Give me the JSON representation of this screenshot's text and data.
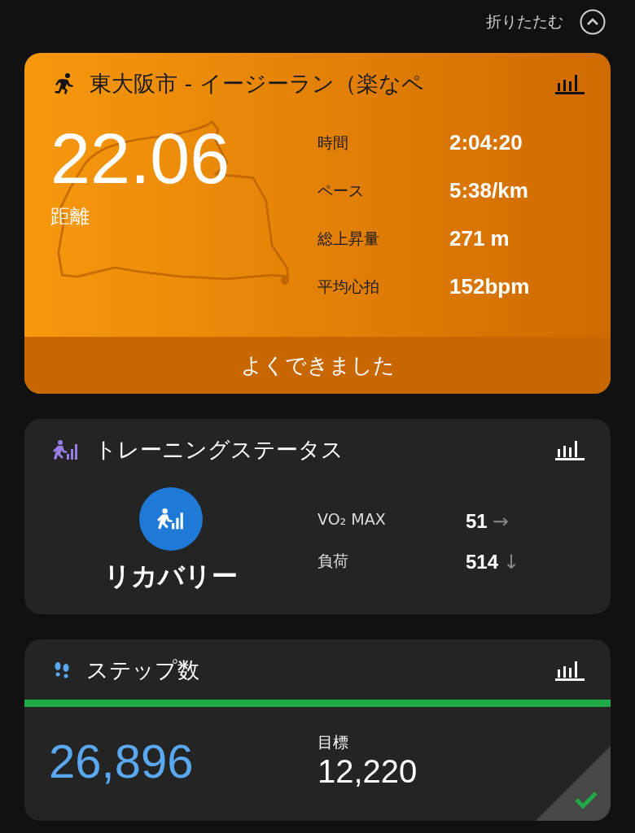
{
  "collapse": {
    "label": "折りたたむ"
  },
  "activity": {
    "title": "東大阪市 - イージーラン（楽なペ",
    "distance": "22.06",
    "distance_label": "距離",
    "stats": [
      {
        "label": "時間",
        "value": "2:04:20"
      },
      {
        "label": "ペース",
        "value": "5:38/km"
      },
      {
        "label": "総上昇量",
        "value": "271 m"
      },
      {
        "label": "平均心拍",
        "value": "152bpm"
      }
    ],
    "message": "よくできました"
  },
  "training_status": {
    "title": "トレーニングステータス",
    "status": "リカバリー",
    "metrics": [
      {
        "label": "VO₂ MAX",
        "value": "51",
        "trend": "→"
      },
      {
        "label": "負荷",
        "value": "514",
        "trend": "↓"
      }
    ]
  },
  "steps": {
    "title": "ステップ数",
    "count": "26,896",
    "goal_label": "目標",
    "goal": "12,220",
    "level": 1,
    "goal_met": true
  }
}
